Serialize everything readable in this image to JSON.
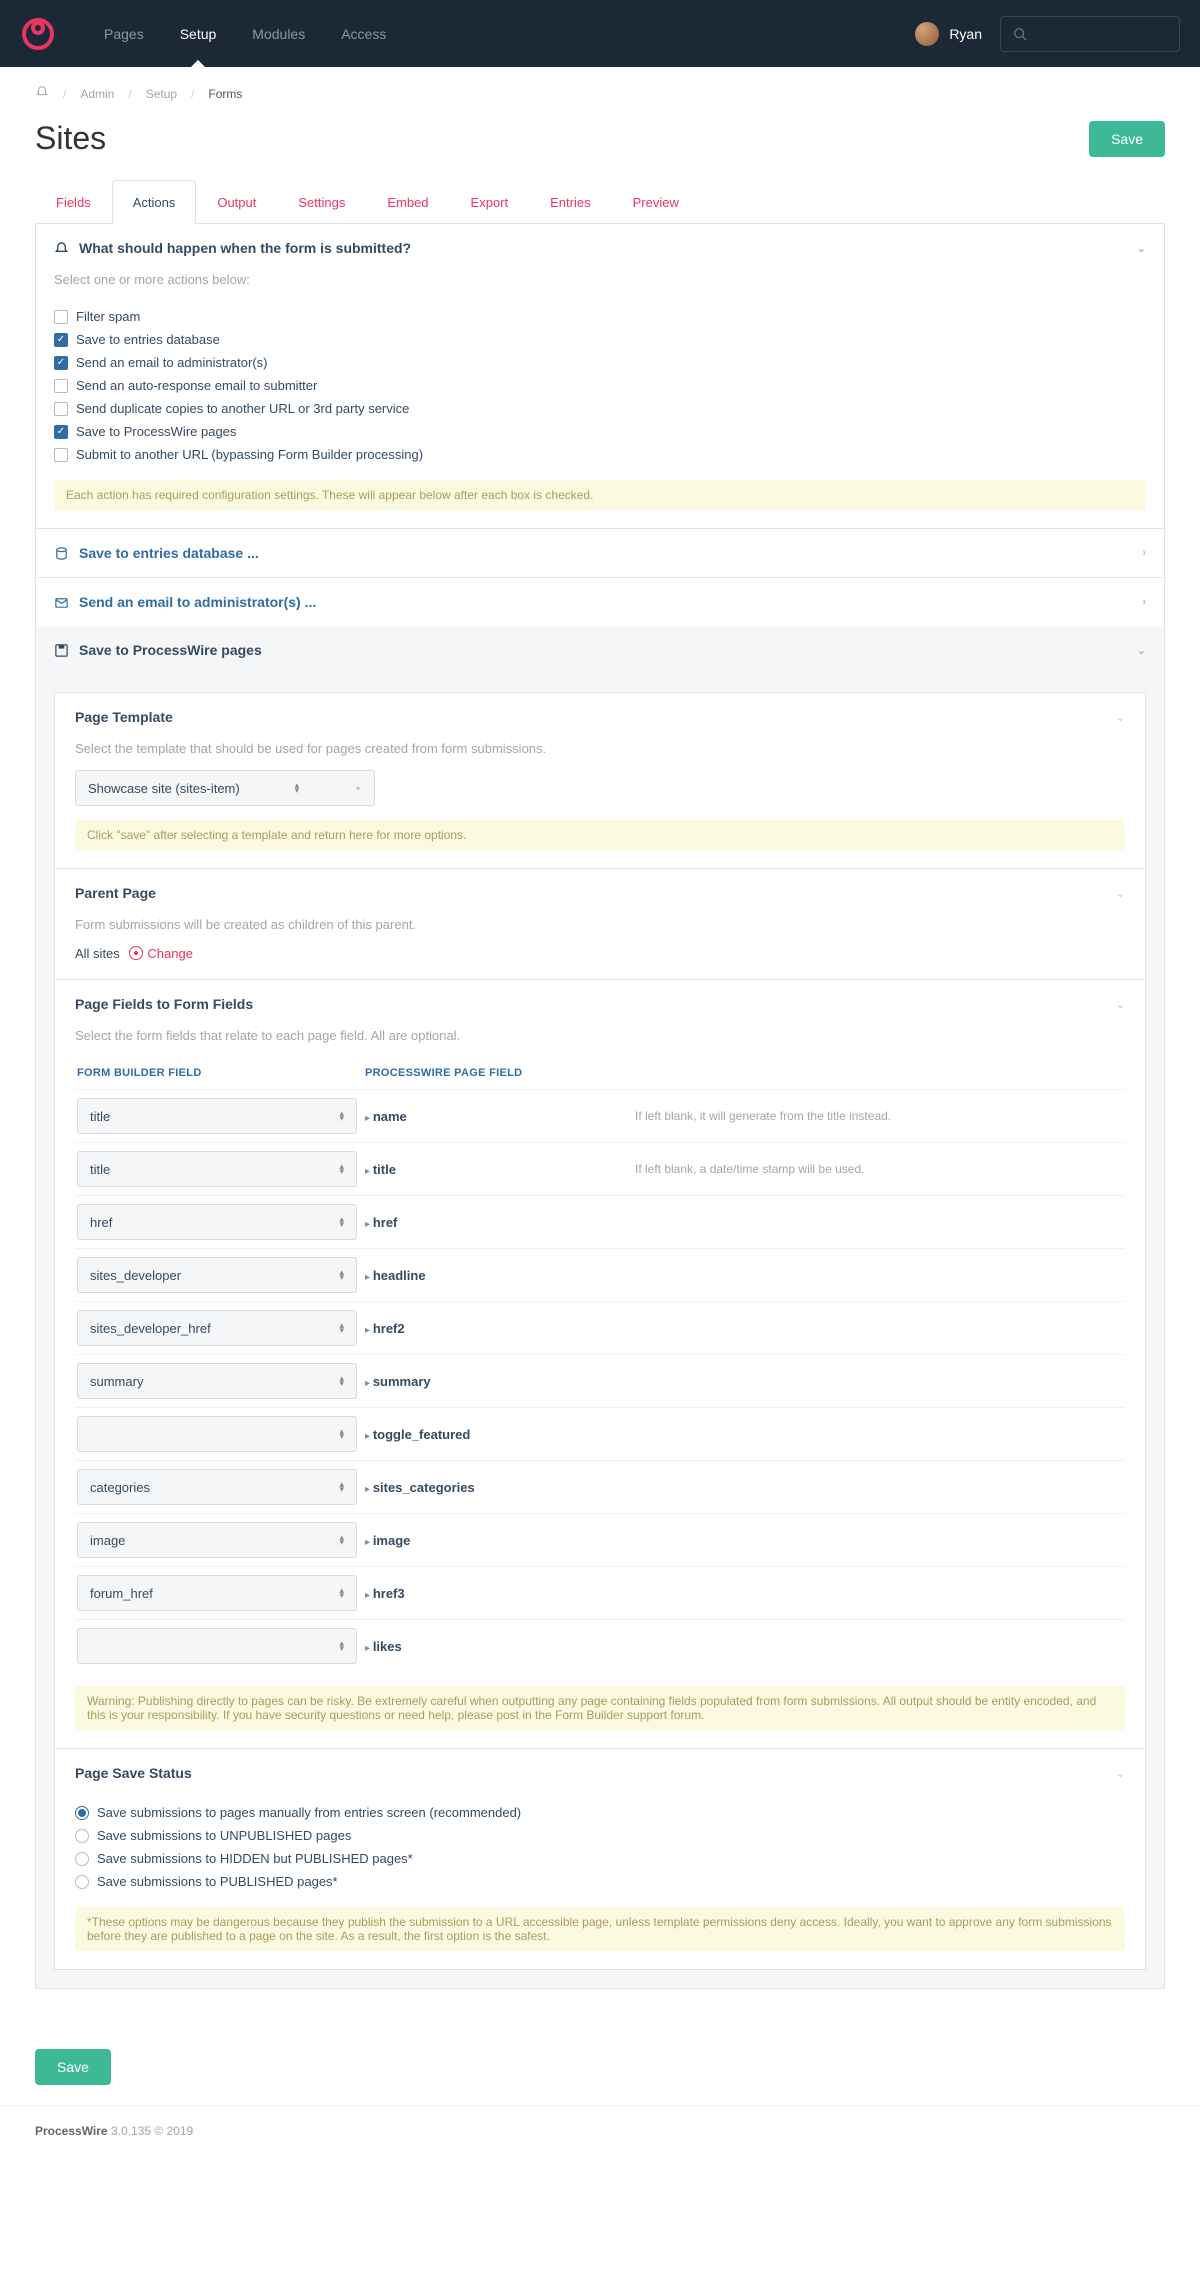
{
  "nav": {
    "items": [
      "Pages",
      "Setup",
      "Modules",
      "Access"
    ],
    "active": 1
  },
  "user": {
    "name": "Ryan"
  },
  "crumbs": {
    "items": [
      "Admin",
      "Setup"
    ],
    "current": "Forms"
  },
  "page": {
    "title": "Sites",
    "save": "Save"
  },
  "tabs": {
    "items": [
      "Fields",
      "Actions",
      "Output",
      "Settings",
      "Embed",
      "Export",
      "Entries",
      "Preview"
    ],
    "active": 1
  },
  "submit": {
    "title": "What should happen when the form is submitted?",
    "desc": "Select one or more actions below:",
    "opts": [
      {
        "label": "Filter spam",
        "on": false
      },
      {
        "label": "Save to entries database",
        "on": true
      },
      {
        "label": "Send an email to administrator(s)",
        "on": true
      },
      {
        "label": "Send an auto-response email to submitter",
        "on": false
      },
      {
        "label": "Send duplicate copies to another URL or 3rd party service",
        "on": false
      },
      {
        "label": "Save to ProcessWire pages",
        "on": true
      },
      {
        "label": "Submit to another URL (bypassing Form Builder processing)",
        "on": false
      }
    ],
    "note": "Each action has required configuration settings. These will appear below after each box is checked."
  },
  "collapsed": [
    {
      "title": "Save to entries database ...",
      "icon": "db"
    },
    {
      "title": "Send an email to administrator(s) ...",
      "icon": "mail"
    }
  ],
  "savePages": {
    "title": "Save to ProcessWire pages",
    "template": {
      "title": "Page Template",
      "desc": "Select the template that should be used for pages created from form submissions.",
      "value": "Showcase site (sites-item)",
      "note": "Click \"save\" after selecting a template and return here for more options."
    },
    "parent": {
      "title": "Parent Page",
      "desc": "Form submissions will be created as children of this parent.",
      "value": "All sites",
      "change": "Change"
    },
    "fields": {
      "title": "Page Fields to Form Fields",
      "desc": "Select the form fields that relate to each page field. All are optional.",
      "h1": "FORM BUILDER FIELD",
      "h2": "PROCESSWIRE PAGE FIELD",
      "rows": [
        {
          "fb": "title",
          "pw": "name",
          "hint": "If left blank, it will generate from the title instead."
        },
        {
          "fb": "title",
          "pw": "title",
          "hint": "If left blank, a date/time stamp will be used."
        },
        {
          "fb": "href",
          "pw": "href",
          "hint": ""
        },
        {
          "fb": "sites_developer",
          "pw": "headline",
          "hint": ""
        },
        {
          "fb": "sites_developer_href",
          "pw": "href2",
          "hint": ""
        },
        {
          "fb": "summary",
          "pw": "summary",
          "hint": ""
        },
        {
          "fb": "",
          "pw": "toggle_featured",
          "hint": ""
        },
        {
          "fb": "categories",
          "pw": "sites_categories",
          "hint": ""
        },
        {
          "fb": "image",
          "pw": "image",
          "hint": ""
        },
        {
          "fb": "forum_href",
          "pw": "href3",
          "hint": ""
        },
        {
          "fb": "",
          "pw": "likes",
          "hint": ""
        }
      ],
      "note": "Warning: Publishing directly to pages can be risky. Be extremely careful when outputting any page containing fields populated from form submissions. All output should be entity encoded, and this is your responsibility. If you have security questions or need help, please post in the Form Builder support forum."
    },
    "status": {
      "title": "Page Save Status",
      "opts": [
        {
          "label": "Save submissions to pages manually from entries screen (recommended)",
          "on": true
        },
        {
          "label": "Save submissions to UNPUBLISHED pages",
          "on": false
        },
        {
          "label": "Save submissions to HIDDEN but PUBLISHED pages*",
          "on": false
        },
        {
          "label": "Save submissions to PUBLISHED pages*",
          "on": false
        }
      ],
      "note": "*These options may be dangerous because they publish the submission to a URL accessible page, unless template permissions deny access. Ideally, you want to approve any form submissions before they are published to a page on the site. As a result, the first option is the safest."
    }
  },
  "footer": {
    "brand": "ProcessWire",
    "ver": "3.0.135 © 2019"
  }
}
